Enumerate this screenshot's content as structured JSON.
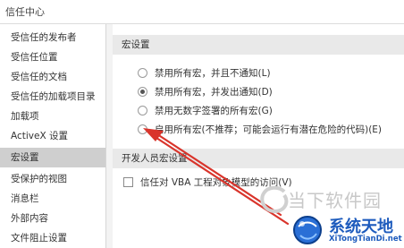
{
  "window": {
    "title": "信任中心"
  },
  "sidebar": {
    "items": [
      {
        "label": "受信任的发布者"
      },
      {
        "label": "受信任位置"
      },
      {
        "label": "受信任的文档"
      },
      {
        "label": "受信任的加载项目录"
      },
      {
        "label": "加载项"
      },
      {
        "label": "ActiveX 设置"
      },
      {
        "label": "宏设置"
      },
      {
        "label": "受保护的视图"
      },
      {
        "label": "消息栏"
      },
      {
        "label": "外部内容"
      },
      {
        "label": "文件阻止设置"
      }
    ],
    "selected_label": "宏设置"
  },
  "macro_settings": {
    "header": "宏设置",
    "options": [
      {
        "label": "禁用所有宏，并且不通知(L)",
        "checked": false
      },
      {
        "label": "禁用所有宏，并发出通知(D)",
        "checked": true
      },
      {
        "label": "禁用无数字签署的所有宏(G)",
        "checked": false
      },
      {
        "label": "启用所有宏(不推荐；可能会运行有潜在危险的代码)(E)",
        "checked": false
      }
    ]
  },
  "developer_settings": {
    "header": "开发人员宏设置",
    "trust_vba_label": "信任对 VBA 工程对象模型的访问(V)"
  },
  "watermark": {
    "site_name_1": "当下软件园",
    "site_name_2": "系统天地",
    "site_url": "XiTongTianDi.net"
  },
  "colors": {
    "arrow": "#d9342b",
    "selected_item_bg": "#cfcfcf",
    "section_header_bg": "#e9e9e9"
  }
}
